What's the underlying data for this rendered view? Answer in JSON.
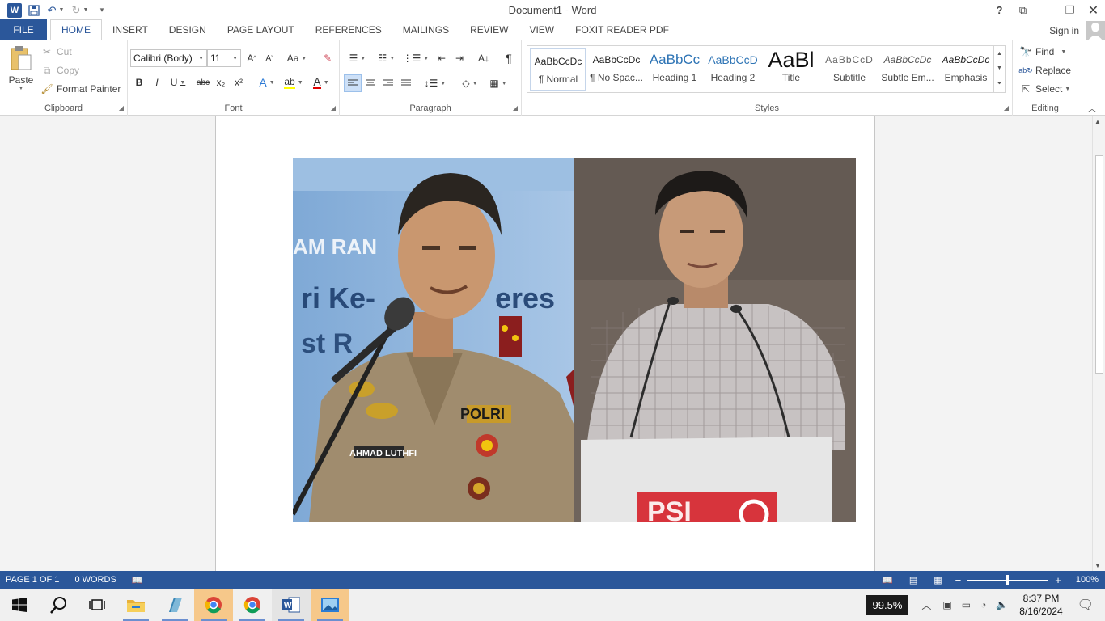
{
  "window": {
    "title": "Document1 - Word"
  },
  "qat": {
    "save": "save-icon",
    "undo": "undo-icon",
    "redo": "redo-icon",
    "customize": "customize-icon"
  },
  "tabs": [
    "FILE",
    "HOME",
    "INSERT",
    "DESIGN",
    "PAGE LAYOUT",
    "REFERENCES",
    "MAILINGS",
    "REVIEW",
    "VIEW",
    "FOXIT READER PDF"
  ],
  "active_tab": "HOME",
  "account": {
    "signin": "Sign in"
  },
  "clipboard": {
    "paste": "Paste",
    "cut": "Cut",
    "copy": "Copy",
    "format_painter": "Format Painter",
    "label": "Clipboard"
  },
  "font": {
    "name": "Calibri (Body)",
    "size": "11",
    "label": "Font",
    "change_case": "Aa",
    "bold": "B",
    "italic": "I",
    "underline": "U",
    "strike": "abc",
    "subscript": "x₂",
    "superscript": "x²",
    "grow": "A",
    "shrink": "A",
    "effects": "A",
    "font_color": "A"
  },
  "paragraph": {
    "label": "Paragraph",
    "pilcrow": "¶"
  },
  "styles": {
    "label": "Styles",
    "items": [
      {
        "preview": "AaBbCcDc",
        "name": "¶ Normal"
      },
      {
        "preview": "AaBbCcDc",
        "name": "¶ No Spac..."
      },
      {
        "preview": "AaBbCc",
        "name": "Heading 1"
      },
      {
        "preview": "AaBbCcD",
        "name": "Heading 2"
      },
      {
        "preview": "AaBl",
        "name": "Title"
      },
      {
        "preview": "AaBbCcD",
        "name": "Subtitle"
      },
      {
        "preview": "AaBbCcDc",
        "name": "Subtle Em..."
      },
      {
        "preview": "AaBbCcDc",
        "name": "Emphasis"
      }
    ]
  },
  "editing": {
    "label": "Editing",
    "find": "Find",
    "replace": "Replace",
    "select": "Select"
  },
  "status": {
    "page": "PAGE 1 OF 1",
    "words": "0 WORDS",
    "zoom": "100%"
  },
  "taskbar": {
    "zoom_badge": "99.5%",
    "time": "8:37 PM",
    "date": "8/16/2024"
  },
  "colors": {
    "word_blue": "#2b579a",
    "heading_blue": "#2e74b5"
  }
}
